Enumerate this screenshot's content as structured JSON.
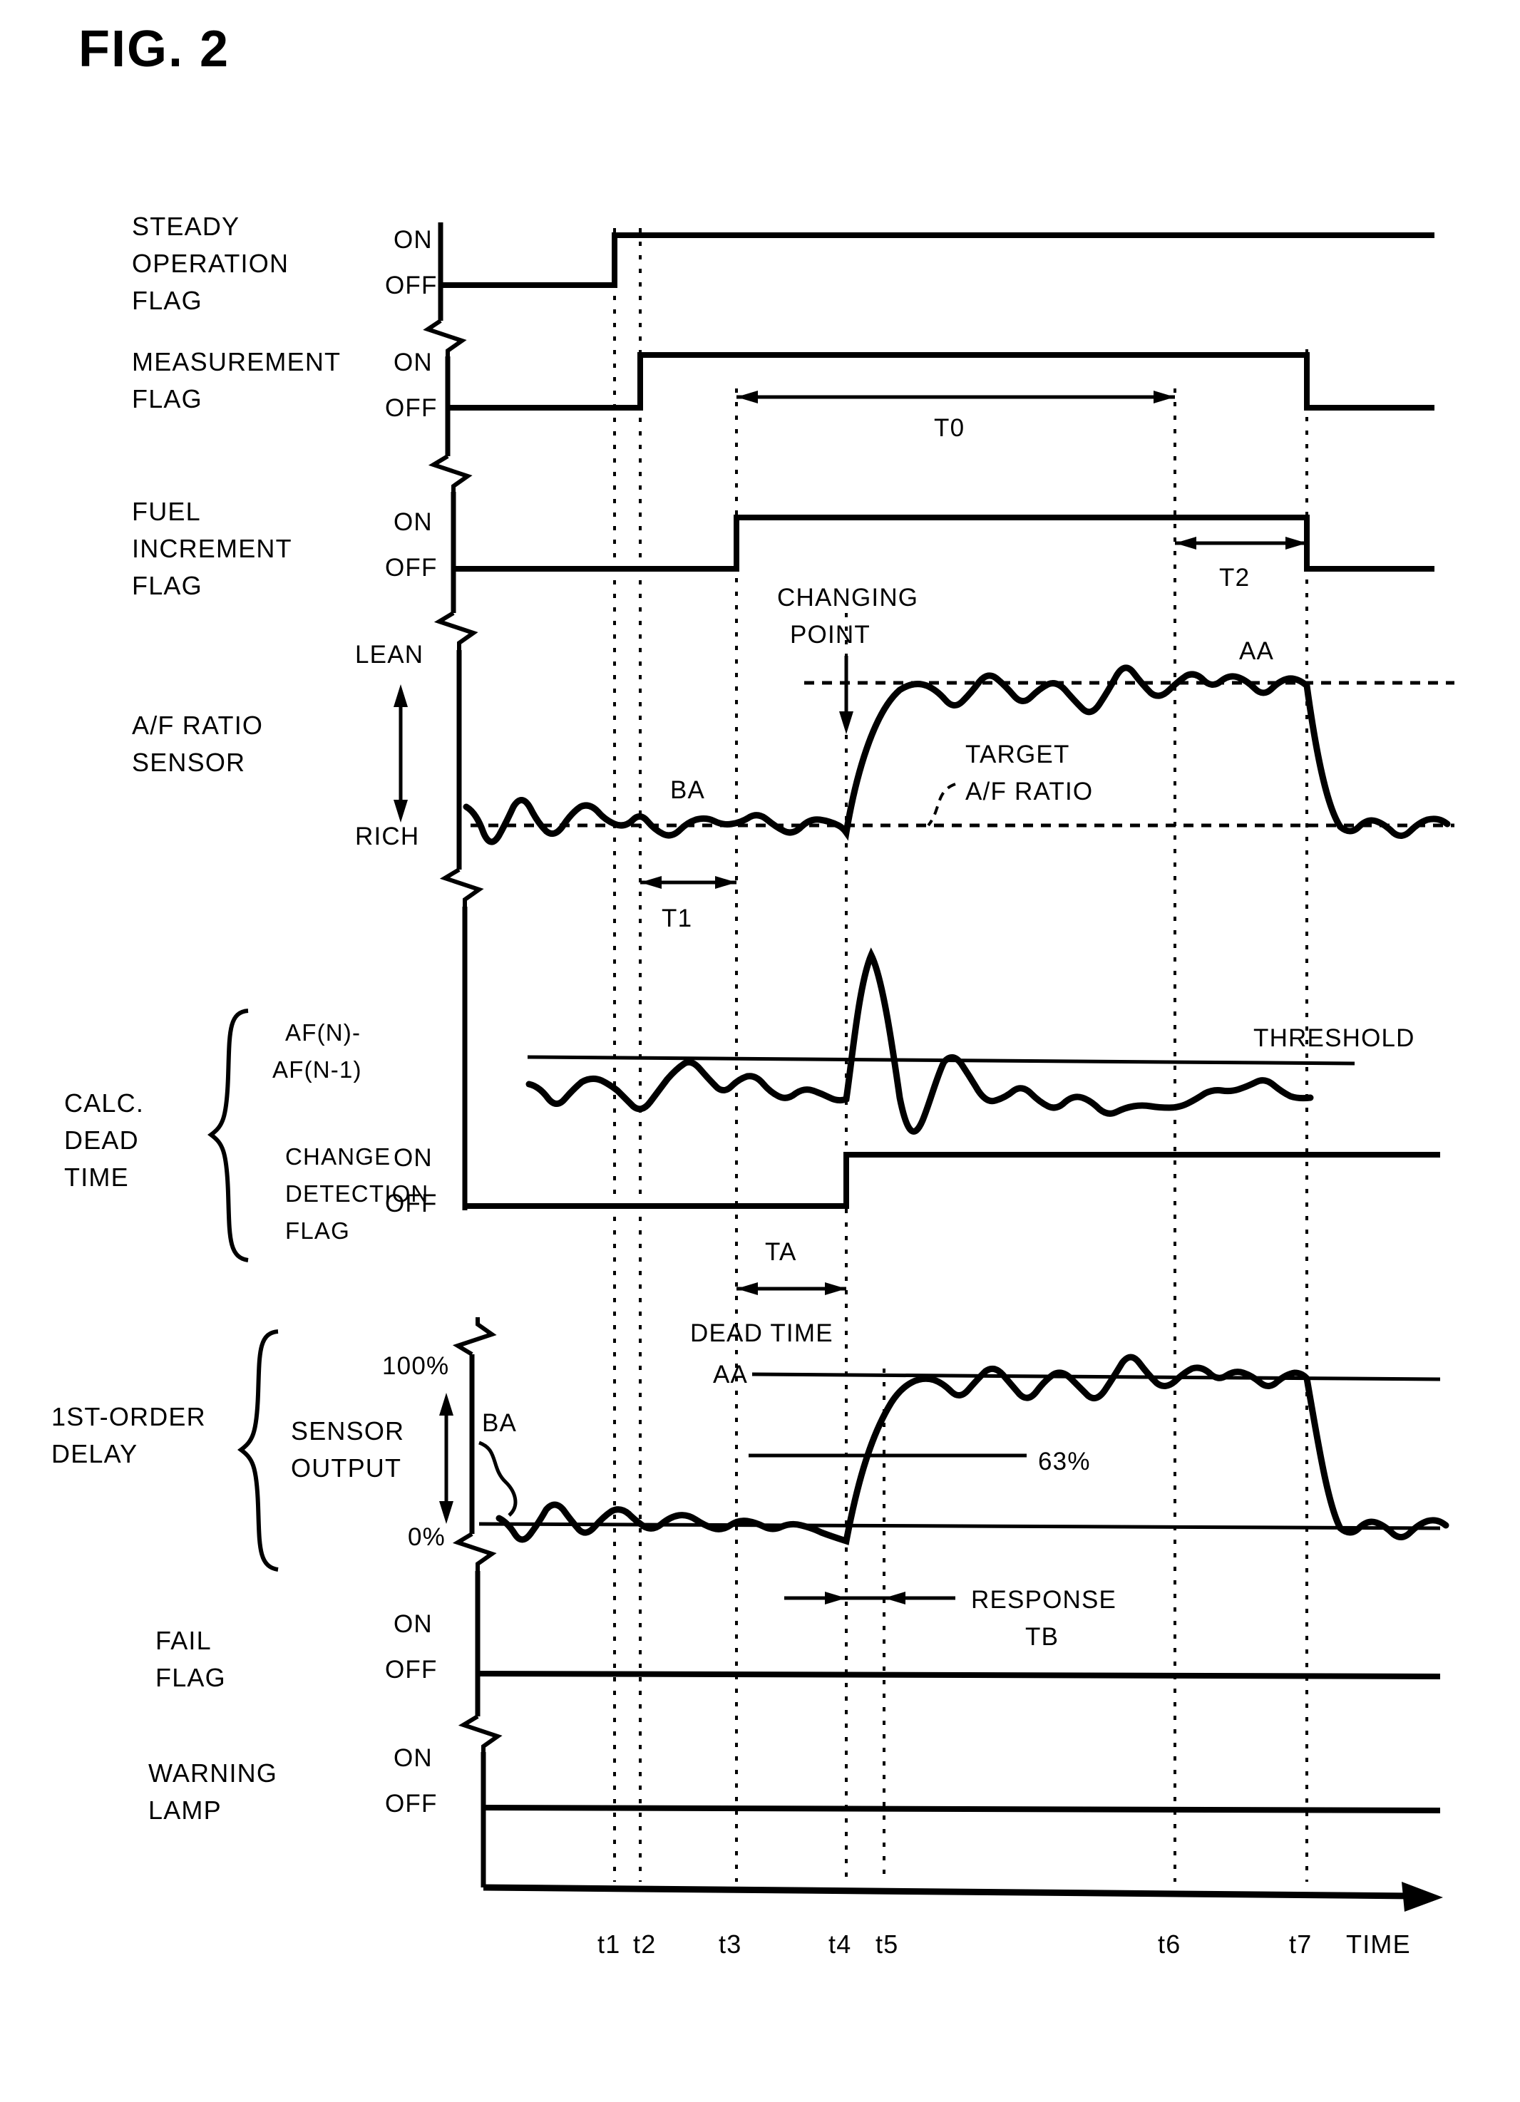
{
  "figure": {
    "title": "FIG. 2",
    "type": "timing-diagram"
  },
  "chart_data": {
    "type": "line",
    "title": "FIG. 2",
    "xlabel": "TIME",
    "ylabel": "",
    "grid": "vertical dotted gridlines at t1..t7",
    "legend": "none",
    "x_tick_labels": [
      "t1",
      "t2",
      "t3",
      "t4",
      "t5",
      "t6",
      "t7"
    ],
    "x_tick_positions": [
      862,
      898,
      1033,
      1187,
      1240,
      1648,
      1833
    ],
    "axis_label_right": "TIME",
    "rows": [
      {
        "name": "STEADY OPERATION FLAG",
        "label_lines": [
          "STEADY",
          "OPERATION",
          "FLAG"
        ],
        "y_levels": [
          "ON",
          "OFF"
        ],
        "waveform": "OFF until t1, then ON through end",
        "transitions": [
          {
            "at": "t1",
            "to": "ON"
          }
        ]
      },
      {
        "name": "MEASUREMENT FLAG",
        "label_lines": [
          "MEASUREMENT",
          "FLAG"
        ],
        "y_levels": [
          "ON",
          "OFF"
        ],
        "waveform": "OFF until t2, ON from t2 to t7, OFF after t7",
        "transitions": [
          {
            "at": "t2",
            "to": "ON"
          },
          {
            "at": "t7",
            "to": "OFF"
          }
        ],
        "annotations": [
          {
            "label": "T0",
            "from": "t3",
            "to": "t6"
          }
        ]
      },
      {
        "name": "FUEL INCREMENT FLAG",
        "label_lines": [
          "FUEL",
          "INCREMENT",
          "FLAG"
        ],
        "y_levels": [
          "ON",
          "OFF"
        ],
        "waveform": "OFF until t3, ON from t3 to t7, OFF after t7",
        "transitions": [
          {
            "at": "t3",
            "to": "ON"
          },
          {
            "at": "t7",
            "to": "OFF"
          }
        ],
        "annotations": [
          {
            "label": "T2",
            "from": "t6",
            "to": "t7"
          }
        ]
      },
      {
        "name": "A/F RATIO SENSOR",
        "label_lines": [
          "A/F RATIO",
          "SENSOR"
        ],
        "y_levels": [
          "LEAN",
          "RICH"
        ],
        "waveform": "oscillates near RICH until t4, rises to LEAN level, oscillates near LEAN until t7, then falls back to RICH",
        "annotations": [
          {
            "label": "BA",
            "kind": "amplitude-before"
          },
          {
            "label": "AA",
            "kind": "amplitude-after"
          },
          {
            "label": "CHANGING POINT",
            "at": "t4"
          },
          {
            "label": "TARGET A/F RATIO",
            "kind": "dashed-reference"
          },
          {
            "label": "T1",
            "from": "t2",
            "to": "t3"
          }
        ]
      },
      {
        "name": "AF(N) - AF(N-1)",
        "label_lines": [
          "AF(N)-",
          "AF(N-1)"
        ],
        "group": "CALC. DEAD TIME",
        "waveform": "small oscillation below threshold, large positive spike exceeding THRESHOLD at t4, then undershoot and settle",
        "annotations": [
          {
            "label": "THRESHOLD",
            "kind": "horizontal-line"
          }
        ]
      },
      {
        "name": "CHANGE DETECTION FLAG",
        "label_lines": [
          "CHANGE",
          "DETECTION",
          "FLAG"
        ],
        "group": "CALC. DEAD TIME",
        "y_levels": [
          "ON",
          "OFF"
        ],
        "waveform": "OFF until t4, then ON through end",
        "transitions": [
          {
            "at": "t4",
            "to": "ON"
          }
        ],
        "annotations": [
          {
            "label": "TA",
            "from": "t3",
            "to": "t4"
          },
          {
            "label": "DEAD TIME",
            "kind": "caption"
          }
        ]
      },
      {
        "name": "SENSOR OUTPUT",
        "label_lines": [
          "SENSOR",
          "OUTPUT"
        ],
        "group": "1ST-ORDER DELAY",
        "y_levels": [
          "100%",
          "0%"
        ],
        "waveform": "oscillates near 0% until t4, first-order rise crossing 63% at t5, settles at AA until t7, then falls to 0%",
        "annotations": [
          {
            "label": "BA",
            "kind": "amplitude-before"
          },
          {
            "label": "AA",
            "kind": "amplitude-after"
          },
          {
            "label": "63%",
            "kind": "horizontal-line"
          },
          {
            "label": "RESPONSE TB",
            "from": "t4",
            "to": "t5"
          }
        ]
      },
      {
        "name": "FAIL FLAG",
        "label_lines": [
          "FAIL",
          "FLAG"
        ],
        "y_levels": [
          "ON",
          "OFF"
        ],
        "waveform": "OFF for entire span",
        "transitions": []
      },
      {
        "name": "WARNING LAMP",
        "label_lines": [
          "WARNING",
          "LAMP"
        ],
        "y_levels": [
          "ON",
          "OFF"
        ],
        "waveform": "OFF for entire span",
        "transitions": []
      }
    ]
  },
  "labels": {
    "row1_l1": "STEADY",
    "row1_l2": "OPERATION",
    "row1_l3": "FLAG",
    "row2_l1": "MEASUREMENT",
    "row2_l2": "FLAG",
    "row3_l1": "FUEL",
    "row3_l2": "INCREMENT",
    "row3_l3": "FLAG",
    "row4_l1": "A/F RATIO",
    "row4_l2": "SENSOR",
    "group_calc_l1": "CALC.",
    "group_calc_l2": "DEAD",
    "group_calc_l3": "TIME",
    "row5_l1": "AF(N)-",
    "row5_l2": "AF(N-1)",
    "row6_l1": "CHANGE",
    "row6_l2": "DETECTION",
    "row6_l3": "FLAG",
    "group_delay_l1": "1ST-ORDER",
    "group_delay_l2": "DELAY",
    "row7_l1": "SENSOR",
    "row7_l2": "OUTPUT",
    "row8_l1": "FAIL",
    "row8_l2": "FLAG",
    "row9_l1": "WARNING",
    "row9_l2": "LAMP"
  },
  "levels": {
    "on": "ON",
    "off": "OFF",
    "lean": "LEAN",
    "rich": "RICH",
    "pct100": "100%",
    "pct0": "0%"
  },
  "annotations": {
    "t0": "T0",
    "t1": "T1",
    "t2": "T2",
    "ta": "TA",
    "tb_line1": "RESPONSE",
    "tb_line2": "TB",
    "dead_time": "DEAD TIME",
    "threshold": "THRESHOLD",
    "changing_point_l1": "CHANGING",
    "changing_point_l2": "POINT",
    "target_l1": "TARGET",
    "target_l2": "A/F RATIO",
    "ba": "BA",
    "aa": "AA",
    "ba2": "BA",
    "aa2": "AA",
    "pct63": "63%"
  },
  "time_axis": {
    "ticks": [
      "t1",
      "t2",
      "t3",
      "t4",
      "t5",
      "t6",
      "t7"
    ],
    "axis_label": "TIME"
  },
  "colors": {
    "ink": "#000000",
    "paper": "#ffffff"
  }
}
